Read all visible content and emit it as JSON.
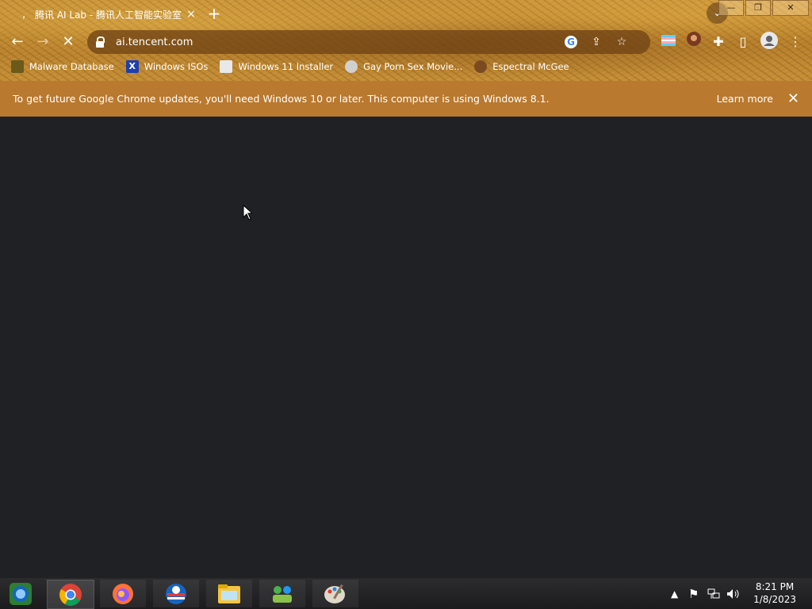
{
  "browser": {
    "tab": {
      "title": "腾讯 AI Lab - 腾讯人工智能实验室",
      "close_icon": "×"
    },
    "new_tab_label": "+",
    "tab_search_icon": "⌄",
    "window": {
      "minimize": "—",
      "restore": "❐",
      "close": "✕"
    },
    "toolbar": {
      "back": "←",
      "forward": "→",
      "stop": "✕",
      "url": "ai.tencent.com",
      "share_icon": "⇪",
      "star_icon": "☆",
      "extensions_icon": "✚",
      "sidepanel_icon": "▯",
      "menu_icon": "⋮"
    },
    "bookmarks": [
      {
        "label": "Malware Database",
        "icon": "folder-icon",
        "color": "#6b5a1a"
      },
      {
        "label": "Windows ISOs",
        "icon": "x-icon",
        "color": "#1e3fb0"
      },
      {
        "label": "Windows 11 Installer",
        "icon": "image-icon",
        "color": "#e8e8e8"
      },
      {
        "label": "Gay Porn Sex Movie...",
        "icon": "globe-icon",
        "color": "#d0d0d0"
      },
      {
        "label": "Espectral McGee",
        "icon": "face-icon",
        "color": "#7a4a20"
      }
    ]
  },
  "infobar": {
    "message": "To get future Google Chrome updates, you'll need Windows 10 or later. This computer is using Windows 8.1.",
    "learn_more": "Learn more",
    "close": "✕"
  },
  "taskbar": {
    "apps": [
      "start-orb",
      "chrome",
      "firefox",
      "edge-globe",
      "file-explorer",
      "network-people",
      "paint"
    ],
    "clock": {
      "time": "8:21 PM",
      "date": "1/8/2023"
    },
    "tray": {
      "overflow": "▲",
      "flag_icon": "⚑",
      "network_icon": "🖧",
      "volume_icon": "🔊"
    }
  },
  "colors": {
    "page_bg": "#202124",
    "infobar_bg": "#b9792f",
    "theme": "#c48e36"
  }
}
